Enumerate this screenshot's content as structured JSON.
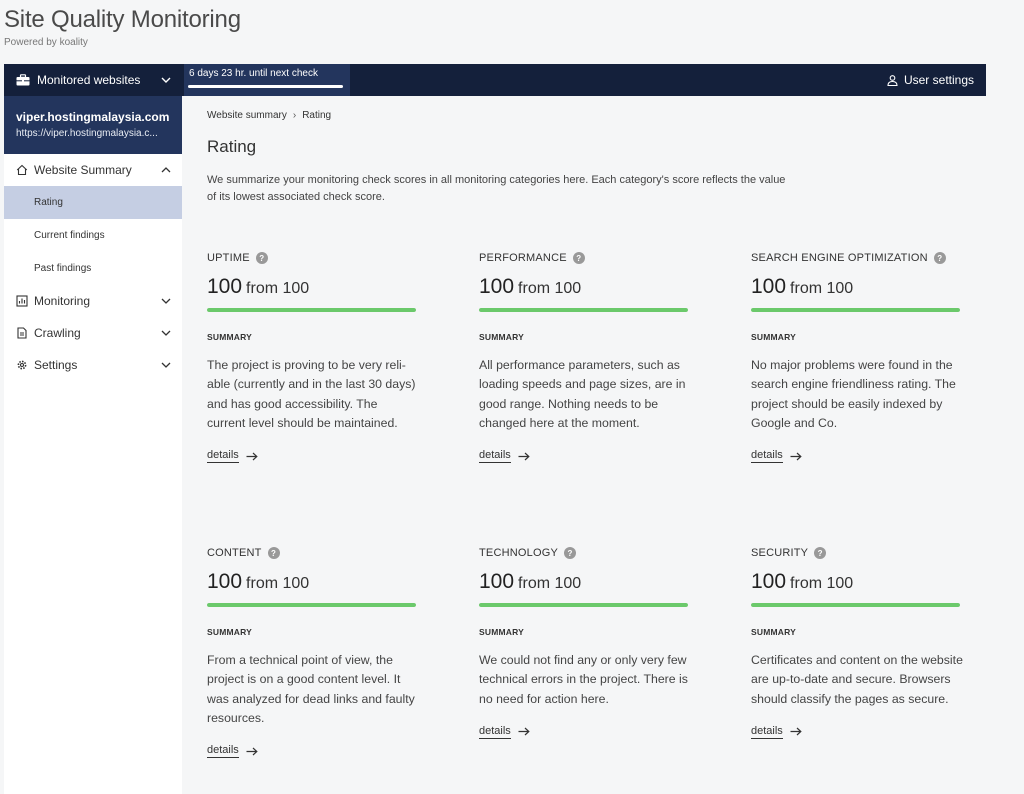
{
  "header": {
    "title": "Site Quality Monitoring",
    "subtitle": "Powered by koality"
  },
  "topbar": {
    "monitored_label": "Monitored websites",
    "next_check": "6 days 23 hr. until next check",
    "next_check_progress": 1.0,
    "user_settings_label": "User settings"
  },
  "sidebar": {
    "site_name": "viper.hostingmalaysia.com",
    "site_url": "https://viper.hostingmalaysia.c...",
    "website_summary": "Website Summary",
    "sub_items": [
      "Rating",
      "Current findings",
      "Past findings"
    ],
    "monitoring": "Monitoring",
    "crawling": "Crawling",
    "settings": "Settings"
  },
  "main": {
    "breadcrumb": [
      "Website summary",
      "Rating"
    ],
    "title": "Rating",
    "description": "We summarize your monitoring check scores in all monitoring categories here. Each category's score reflects the value of its lowest associated check score.",
    "summary_label": "SUMMARY",
    "details_label": "details",
    "from_text": "from 100",
    "cards": [
      {
        "category": "UPTIME",
        "score": "100",
        "progress": 1.0,
        "summary": "The project is proving to be very reli­able (currently and in the last 30 days) and has good accessibility. The current level should be main­tained."
      },
      {
        "category": "PERFORMANCE",
        "score": "100",
        "progress": 1.0,
        "summary": "All performance parameters, such as loading speeds and page sizes, are in good range. Nothing needs to be changed here at the moment."
      },
      {
        "category": "SEARCH ENGINE OPTIMIZATION",
        "score": "100",
        "progress": 1.0,
        "summary": "No major problems were found in the search engine friendliness rat­ing. The project should be easily in­dexed by Google and Co."
      },
      {
        "category": "CONTENT",
        "score": "100",
        "progress": 1.0,
        "summary": "From a technical point of view, the project is on a good content level. It was analyzed for dead links and faulty resources."
      },
      {
        "category": "TECHNOLOGY",
        "score": "100",
        "progress": 1.0,
        "summary": "We could not find any or only very few technical errors in the project. There is no need for action here."
      },
      {
        "category": "SECURITY",
        "score": "100",
        "progress": 1.0,
        "summary": "Certificates and content on the web­site are up-to-date and secure. Browsers should classify the pages as secure."
      }
    ]
  },
  "colors": {
    "topbar": "#14203b",
    "accent": "#23355d",
    "active_nav": "#c5cee3",
    "score_bar": "#6bc96b"
  },
  "icons": {
    "monitored": "briefcase-icon",
    "user": "user-icon",
    "summary": "home-icon",
    "monitoring": "chart-icon",
    "crawling": "document-icon",
    "settings": "gear-icon",
    "help": "help-circle-icon",
    "details": "arrow-right-icon"
  }
}
